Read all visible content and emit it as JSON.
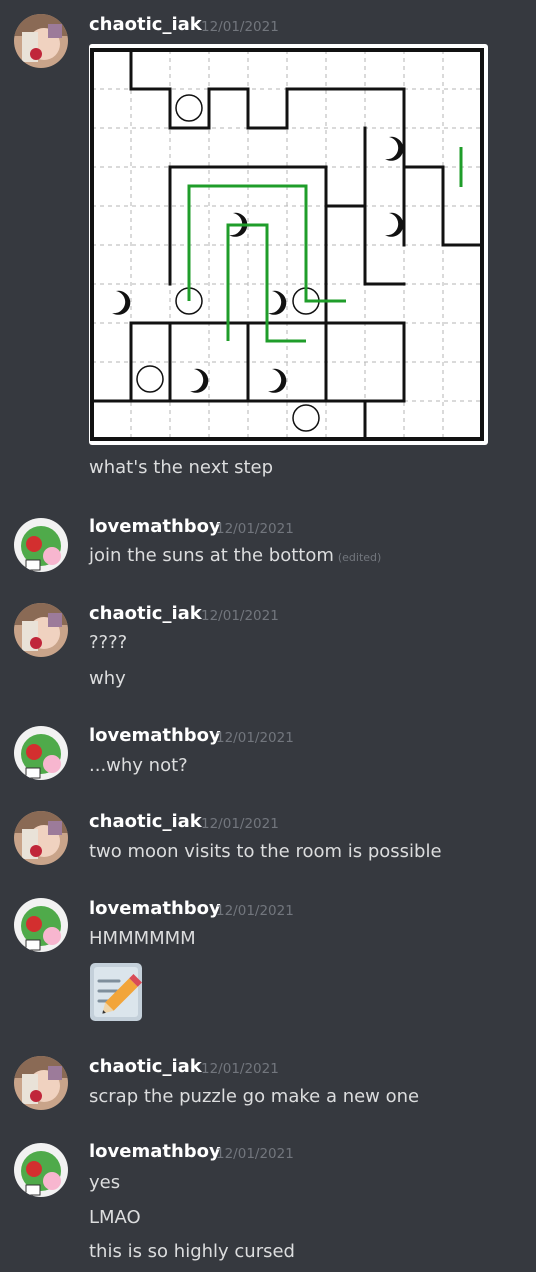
{
  "messages": [
    {
      "author": "chaotic_iak",
      "timestamp": "12/01/2021",
      "lines": [
        "what's the next step"
      ]
    },
    {
      "author": "lovemathboy",
      "timestamp": "12/01/2021",
      "lines": [
        "join the suns at the bottom"
      ],
      "edited_label": "(edited)"
    },
    {
      "author": "chaotic_iak",
      "timestamp": "12/01/2021",
      "lines": [
        "????",
        "why"
      ]
    },
    {
      "author": "lovemathboy",
      "timestamp": "12/01/2021",
      "lines": [
        "...why not?"
      ]
    },
    {
      "author": "chaotic_iak",
      "timestamp": "12/01/2021",
      "lines": [
        "two moon visits to the room is possible"
      ]
    },
    {
      "author": "lovemathboy",
      "timestamp": "12/01/2021",
      "lines": [
        "HMMMMMM"
      ],
      "emoji": "memo-pencil-emoji"
    },
    {
      "author": "chaotic_iak",
      "timestamp": "12/01/2021",
      "lines": [
        "scrap the puzzle go make a new one"
      ]
    },
    {
      "author": "lovemathboy",
      "timestamp": "12/01/2021",
      "lines": [
        "yes",
        "LMAO",
        "this is so highly cursed"
      ]
    }
  ],
  "colors": {
    "background": "#36393f",
    "username": "#ffffff",
    "timestamp": "#72767d",
    "text": "#dcddde",
    "puzzle_line": "#1f9d2a"
  }
}
